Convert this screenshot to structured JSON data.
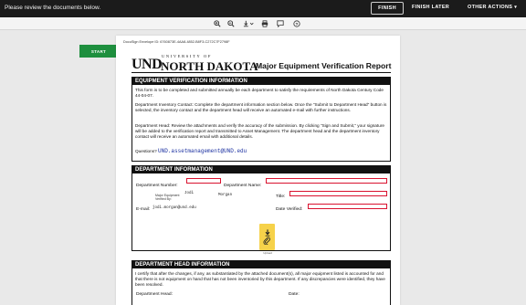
{
  "topbar": {
    "message": "Please review the documents below.",
    "finish": "FINISH",
    "finish_later": "FINISH LATER",
    "other_actions": "OTHER ACTIONS",
    "other_actions_caret": "▾"
  },
  "toolbar": {
    "icons": [
      "zoom-in-icon",
      "zoom-out-icon",
      "download-icon",
      "print-icon",
      "comment-icon",
      "help-icon"
    ]
  },
  "start_button": "START",
  "document": {
    "envelope_id": "DocuSign Envelope ID: 6760873E-4AA8-4852-B8F3-C272C7F2798F",
    "logo": {
      "und": "UND",
      "university_of": "UNIVERSITY OF",
      "north_dakota": "NORTH DAKOTA"
    },
    "title": "Major Equipment Verification Report",
    "sections": {
      "info": {
        "heading": "EQUIPMENT VERIFICATION INFORMATION",
        "p1": "This form is to be completed and submitted annually be each department to satisfy the requirements of North Dakota Century Code 44-04-07.",
        "p2": "Department Inventory Contact: Complete the department information section below. Once the \"Submit to Department Head\" button is selected, the inventory contact and the department head will receive an automated e-mail with further instructions.",
        "p3": "Department Head: Review the attachments and verify the accuracy of the submission. By clicking \"Sign and Submit,\" your signature will be added to the verification report and transmitted to Asset Management. The department head and the department inventory contact will receive an automated email with additional details.",
        "questions_label": "Questions?",
        "questions_email": "UND.assetmanagement@UND.edu"
      },
      "dept": {
        "heading": "DEPARTMENT INFORMATION",
        "dept_number": "Department Number:",
        "dept_name": "Department Name:",
        "verified_by_small": "Major Equipment",
        "verified_by_small2": "Verified By:",
        "first_name": "Jodi",
        "last_name": "Morgan",
        "title": "Title:",
        "email_label": "E-mail:",
        "email_value": "jodi.morgan@und.edu",
        "date_verified": "Date Verified:"
      },
      "attachment_caption": "Upload",
      "head": {
        "heading": "DEPARTMENT HEAD INFORMATION",
        "p1": "I certify that after the changes, if any, as substantiated by the attached document(s), all major equipment listed is accounted for and that there is not equipment on hand that has not been inventoried by this department. If any discrepancies were identified, they have been resolved.",
        "dept_head": "Department Head:",
        "date": "Date:"
      }
    }
  },
  "colors": {
    "start_green": "#1e8f3e",
    "field_red": "#d9122f",
    "attach_yellow": "#f6d24a",
    "topbar": "#1b1b1b"
  }
}
